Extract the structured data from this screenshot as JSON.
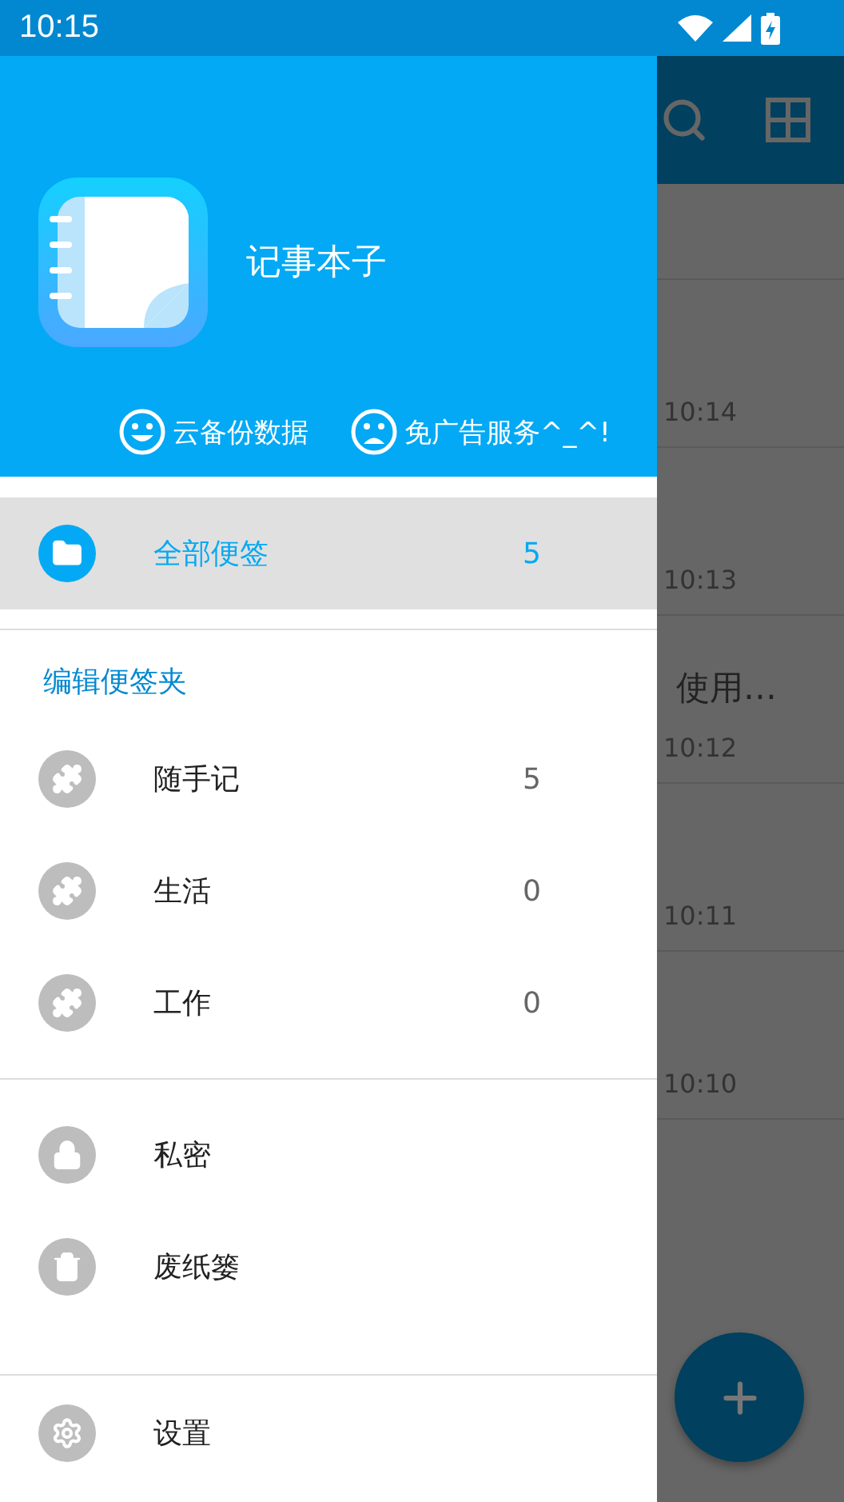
{
  "status_bar": {
    "time": "10:15"
  },
  "drawer": {
    "app_name": "记事本子",
    "actions": [
      {
        "label": "云备份数据",
        "kind": "happy"
      },
      {
        "label": "免广告服务^_^!",
        "kind": "sad"
      }
    ],
    "nav": [
      {
        "label": "全部便签",
        "count": "5",
        "kind": "folder",
        "selected": true
      }
    ],
    "folders_header": "编辑便签夹",
    "folders": [
      {
        "label": "随手记",
        "count": "5",
        "kind": "puzzle",
        "selected": false
      },
      {
        "label": "生活",
        "count": "0",
        "kind": "puzzle",
        "selected": false
      },
      {
        "label": "工作",
        "count": "0",
        "kind": "puzzle",
        "selected": false
      }
    ],
    "extras": [
      {
        "label": "私密",
        "kind": "lock",
        "selected": false
      },
      {
        "label": "废纸篓",
        "kind": "trash",
        "selected": false
      }
    ],
    "settings": {
      "label": "设置",
      "kind": "gear"
    }
  },
  "background": {
    "rows": [
      {
        "time": "10:14"
      },
      {
        "time": "10:13"
      },
      {
        "title": "使用…",
        "time": "10:12"
      },
      {
        "time": "10:11"
      },
      {
        "time": "10:10"
      }
    ]
  }
}
